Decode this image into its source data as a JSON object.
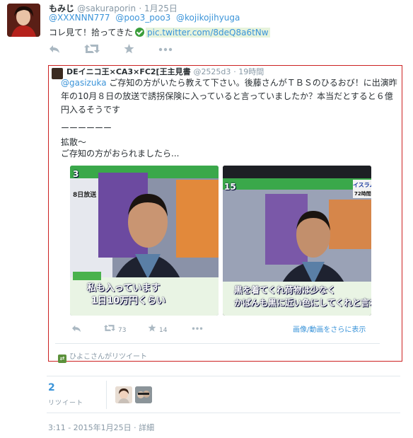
{
  "tweet": {
    "author_name": "もみじ",
    "author_handle": "@sakuraporin",
    "date": "· 1月25日",
    "mentions": [
      "@XXXNNN777",
      "@poo3_poo3",
      "@kojikojihyuga"
    ],
    "text": "コレ見て！拾ってきた",
    "link": "pic.twitter.com/8deQ8a6tNw",
    "actions": {
      "reply_icon": "reply-icon",
      "retweet_icon": "retweet-icon",
      "favorite_icon": "star-icon",
      "more_icon": "more-icon"
    }
  },
  "quoted": {
    "author_name": "DEイニコ王×CA3×FC2[王主見書",
    "author_handle": "@2525d3",
    "time": "· 19時間",
    "mention": "@gasizuka",
    "text": "ご存知の方がいたら教えて下さい。後藤さんがＴＢＳのひるおび！に出演昨年の10月８日の放送で誘拐保険に入っていると言っていましたか？本当だとすると６億円入るそうです",
    "line1": "ーーーーーー",
    "line2": "拡散〜",
    "line3": "ご存知の方がおられましたら...",
    "image1_caption1": "私も入っています",
    "image1_caption2": "1日10万円くらい",
    "image1_tag": "8日放送",
    "image1_number": "3",
    "image2_caption1": "黒を着てくれ荷物は少なく",
    "image2_caption2": "かばんも黒に近い色にしてくれと言われ",
    "image2_tag": "イスラム",
    "image2_tag2": "72時間",
    "image2_number": "15",
    "retweets": "73",
    "favorites": "14",
    "more_media": "画像/動画をさらに表示",
    "retweeted_by": "ひよこさんがリツイート"
  },
  "stats": {
    "retweet_count": "2",
    "retweet_label": "リツイート"
  },
  "timestamp": "3:11 - 2015年1月25日 · 詳細",
  "colors": {
    "link": "#3b94d9",
    "muted": "#8899a6",
    "quote_border": "#cc2222",
    "verified": "#3b9e3b"
  }
}
